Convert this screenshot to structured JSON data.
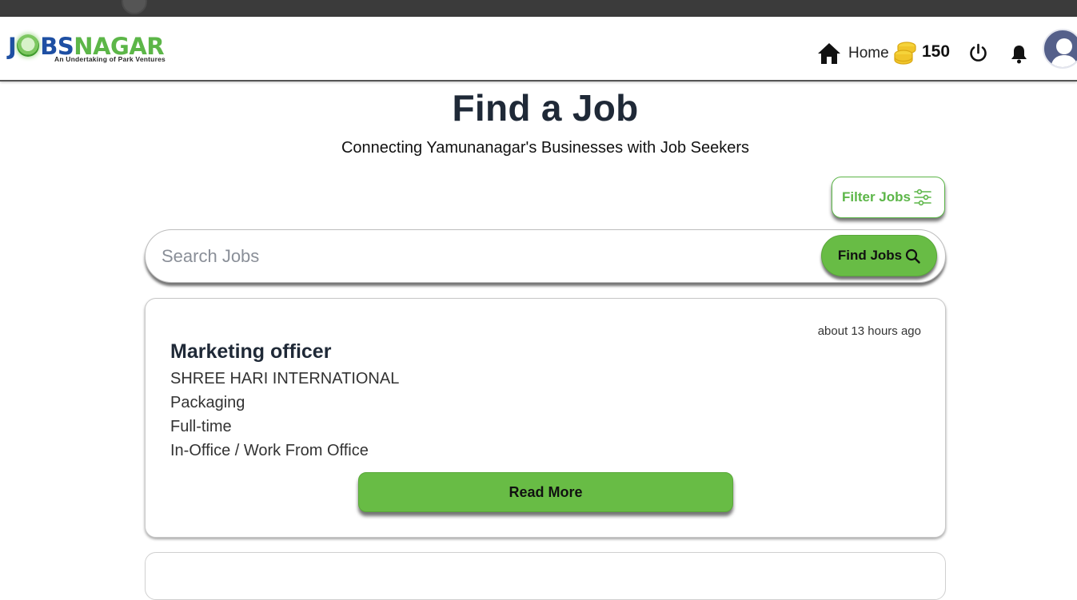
{
  "brand": {
    "logo_j": "J",
    "logo_bs": "BS",
    "logo_nagar": "NAGAR",
    "tagline": "An Undertaking of Park Ventures"
  },
  "nav": {
    "home_label": "Home",
    "coins": "150",
    "home_icon": "home-icon",
    "coins_icon": "coins-icon",
    "power_icon": "power-icon",
    "bell_icon": "bell-icon",
    "avatar_icon": "user-avatar-icon"
  },
  "page": {
    "title": "Find a Job",
    "subtitle": "Connecting Yamunanagar's Businesses with Job Seekers"
  },
  "filter": {
    "label": "Filter Jobs",
    "icon": "sliders-icon"
  },
  "search": {
    "placeholder": "Search Jobs",
    "value": "",
    "button_label": "Find Jobs",
    "button_icon": "search-icon"
  },
  "jobs": [
    {
      "posted": "about 13 hours ago",
      "title": "Marketing officer",
      "company": "SHREE HARI INTERNATIONAL",
      "category": "Packaging",
      "type": "Full-time",
      "mode": "In-Office / Work From Office",
      "action_label": "Read More"
    }
  ],
  "colors": {
    "accent_green": "#68bc45",
    "brand_blue": "#1e4fa3",
    "brand_green": "#5cb648",
    "text_dark": "#1f2937"
  }
}
